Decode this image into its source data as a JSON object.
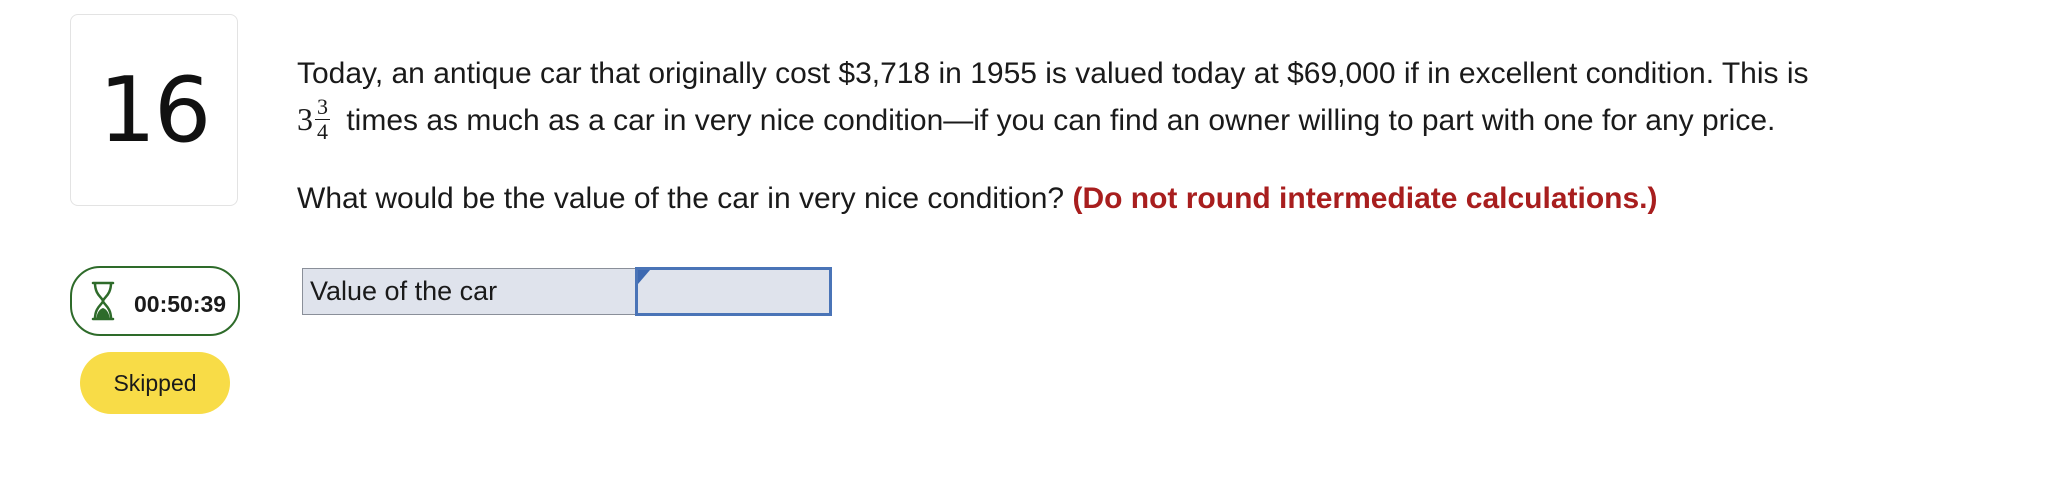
{
  "question": {
    "number": "16",
    "line1": "Today, an antique car that originally cost $3,718 in 1955 is valued today at $69,000 if in excellent condition. This is",
    "mixed_whole": "3",
    "mixed_numerator": "3",
    "mixed_denominator": "4",
    "line2": "times as much as a car in very nice condition—if you can find an owner willing to part with one for any price.",
    "ask": "What would be the value of the car in very nice condition?",
    "note": "(Do not round intermediate calculations.)"
  },
  "timer": {
    "icon": "hourglass-icon",
    "value": "00:50:39",
    "border_color": "#2e6b2a"
  },
  "status": {
    "label": "Skipped",
    "color": "#f8dc47"
  },
  "answer": {
    "label": "Value of the car",
    "value": "",
    "input_border_color": "#4a74b7"
  },
  "colors": {
    "note_red": "#a81e1e"
  }
}
